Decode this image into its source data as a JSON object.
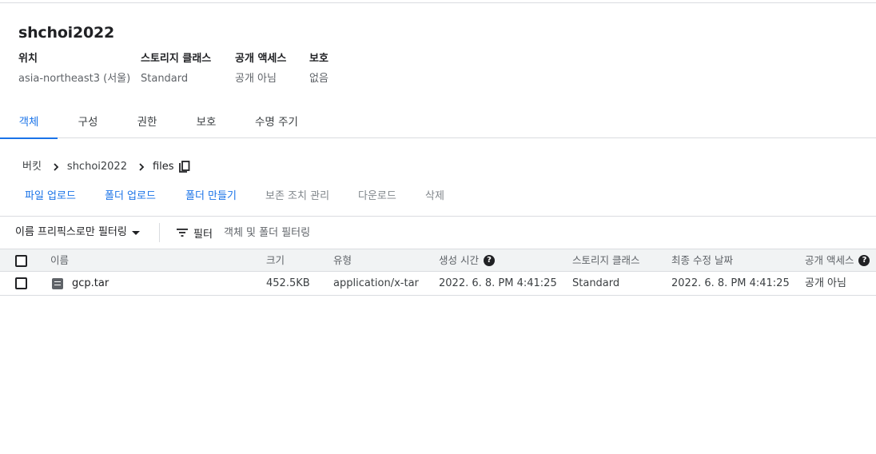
{
  "bucket": {
    "name": "shchoi2022",
    "meta": [
      {
        "label": "위치",
        "value": "asia-northeast3 (서울)"
      },
      {
        "label": "스토리지 클래스",
        "value": "Standard"
      },
      {
        "label": "공개 액세스",
        "value": "공개 아님"
      },
      {
        "label": "보호",
        "value": "없음"
      }
    ]
  },
  "tabs": [
    "객체",
    "구성",
    "권한",
    "보호",
    "수명 주기"
  ],
  "active_tab": "객체",
  "breadcrumb": [
    "버킷",
    "shchoi2022",
    "files"
  ],
  "actions": [
    {
      "label": "파일 업로드",
      "enabled": true
    },
    {
      "label": "폴더 업로드",
      "enabled": true
    },
    {
      "label": "폴더 만들기",
      "enabled": true
    },
    {
      "label": "보존 조치 관리",
      "enabled": false
    },
    {
      "label": "다운로드",
      "enabled": false
    },
    {
      "label": "삭제",
      "enabled": false
    }
  ],
  "filter": {
    "prefix_dropdown": "이름 프리픽스로만 필터링",
    "filter_label": "필터",
    "placeholder": "객체 및 폴더 필터링"
  },
  "table": {
    "headers": {
      "name": "이름",
      "size": "크기",
      "type": "유형",
      "created": "생성 시간",
      "storage_class": "스토리지 클래스",
      "modified": "최종 수정 날짜",
      "public_access": "공개 액세스"
    },
    "rows": [
      {
        "name": "gcp.tar",
        "size": "452.5KB",
        "type": "application/x-tar",
        "created": "2022. 6. 8. PM 4:41:25",
        "storage_class": "Standard",
        "modified": "2022. 6. 8. PM 4:41:25",
        "public_access": "공개 아님"
      }
    ]
  },
  "icons": {
    "breadcrumb_separator": "chevron-right-icon",
    "copy": "copy-icon",
    "filter": "filter-list-icon",
    "help": "help-icon",
    "file": "file-icon",
    "dropdown": "arrow-drop-down-icon"
  },
  "colors": {
    "accent": "#1a73e8",
    "text": "#202124",
    "muted": "#5f6368",
    "disabled": "#80868b",
    "border": "#dadce0",
    "header_bg": "#f1f3f4"
  }
}
